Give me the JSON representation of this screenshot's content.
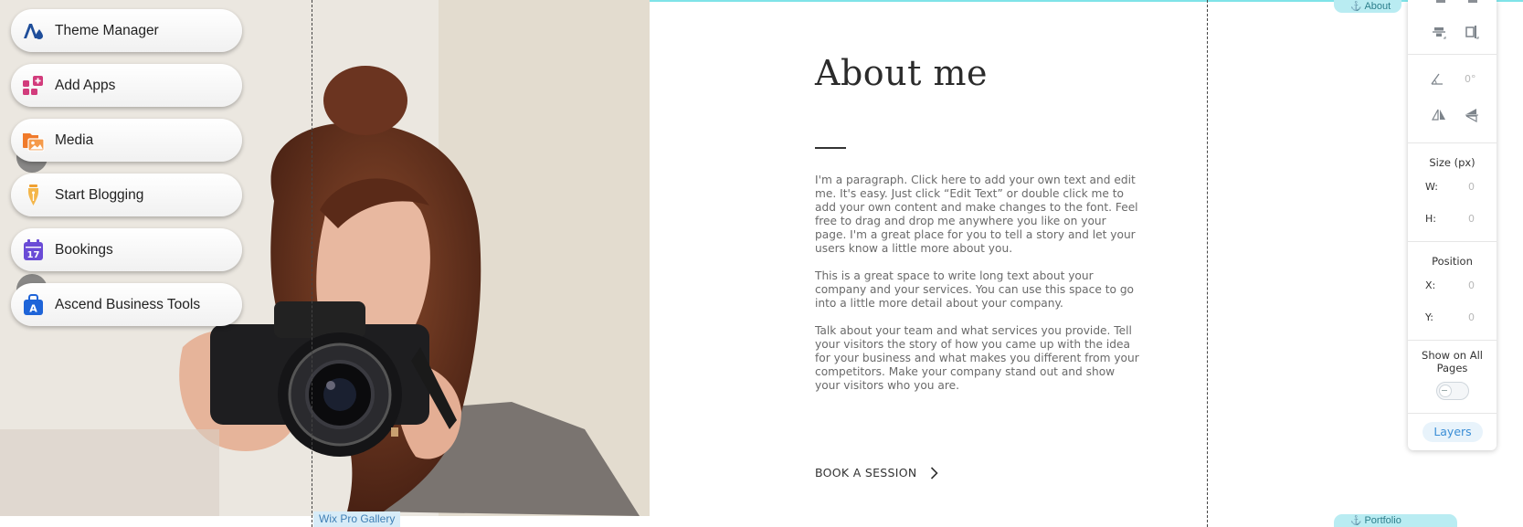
{
  "gallery": {
    "label": "Wix Pro Gallery"
  },
  "content": {
    "title": "About me",
    "paragraphs": [
      "I'm a paragraph. Click here to add your own text and edit me. It's easy. Just click “Edit Text” or double click me to add your own content and make changes to the font. Feel free to drag and drop me anywhere you like on your page. I'm a great place for you to tell a story and let your users know a little more about you.",
      "This is a great space to write long text about your company and your services. You can use this space to go into a little more detail about your company.",
      "Talk about your team and what services you provide. Tell your visitors the story of how you came up with the idea for your business and what makes you different from your competitors. Make your company stand out and show your visitors who you are."
    ],
    "cta": "BOOK A SESSION"
  },
  "sidebar": {
    "items": [
      {
        "label": "Theme Manager",
        "icon": "theme-manager-icon",
        "color": "#1f4e9a"
      },
      {
        "label": "Add Apps",
        "icon": "add-apps-icon",
        "color": "#d23c7c"
      },
      {
        "label": "Media",
        "icon": "media-icon",
        "color": "#f07a2a"
      },
      {
        "label": "Start Blogging",
        "icon": "blog-pen-icon",
        "color": "#f0a030"
      },
      {
        "label": "Bookings",
        "icon": "calendar-icon",
        "color": "#6a4bd6"
      },
      {
        "label": "Ascend Business Tools",
        "icon": "ascend-bag-icon",
        "color": "#1e64d8"
      }
    ],
    "bookings_day": "17",
    "ascend_letter": "A"
  },
  "tags": {
    "top": "About",
    "bottom": "Portfolio"
  },
  "panel": {
    "rotation": "0°",
    "size_header": "Size (px)",
    "w_label": "W:",
    "w_value": "0",
    "h_label": "H:",
    "h_value": "0",
    "position_header": "Position",
    "x_label": "X:",
    "x_value": "0",
    "y_label": "Y:",
    "y_value": "0",
    "show_all_pages": "Show on All Pages",
    "show_all_pages_on": false,
    "layers": "Layers"
  },
  "colors": {
    "accent": "#3b8ed6",
    "guide_line": "#7fe3e8"
  }
}
